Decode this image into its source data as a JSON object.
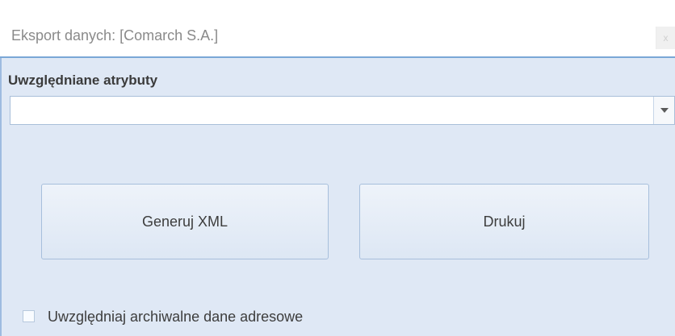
{
  "window": {
    "title": "Eksport danych: [Comarch S.A.]",
    "close_label": "x"
  },
  "attributes": {
    "label": "Uwzględniane atrybuty",
    "selected_value": ""
  },
  "buttons": {
    "generate_xml": "Generuj XML",
    "print": "Drukuj"
  },
  "options": {
    "include_archived_address": {
      "label": "Uwzględniaj archiwalne dane adresowe",
      "checked": false
    }
  },
  "colors": {
    "panel_background": "#dfe8f5",
    "accent_border": "#7aa7d6",
    "button_border": "#a7bfdc"
  },
  "icons": {
    "dropdown": "chevron-down-icon",
    "close": "close-icon"
  }
}
